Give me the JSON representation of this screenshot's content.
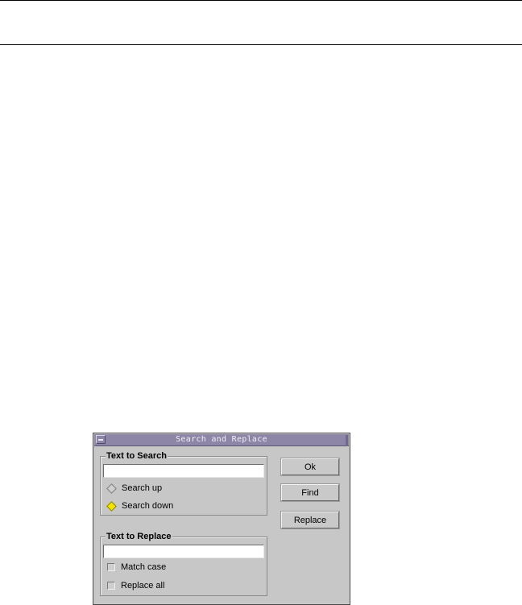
{
  "dialog": {
    "title": "Search and Replace",
    "search_group": {
      "legend": "Text to Search",
      "input_value": "",
      "options": [
        {
          "label": "Search up",
          "selected": false
        },
        {
          "label": "Search down",
          "selected": true
        }
      ]
    },
    "replace_group": {
      "legend": "Text to Replace",
      "input_value": "",
      "options": [
        {
          "label": "Match case",
          "checked": false
        },
        {
          "label": "Replace all",
          "checked": false
        }
      ]
    },
    "buttons": {
      "ok": "Ok",
      "find": "Find",
      "replace": "Replace"
    }
  },
  "icons": {
    "window_menu": "window-menu-icon",
    "radio": "diamond-radio-icon",
    "checkbox": "square-checkbox-icon"
  },
  "colors": {
    "titlebar": "#8e86a7",
    "window_bg": "#c7c7c7",
    "radio_selected": "#f2e400"
  }
}
